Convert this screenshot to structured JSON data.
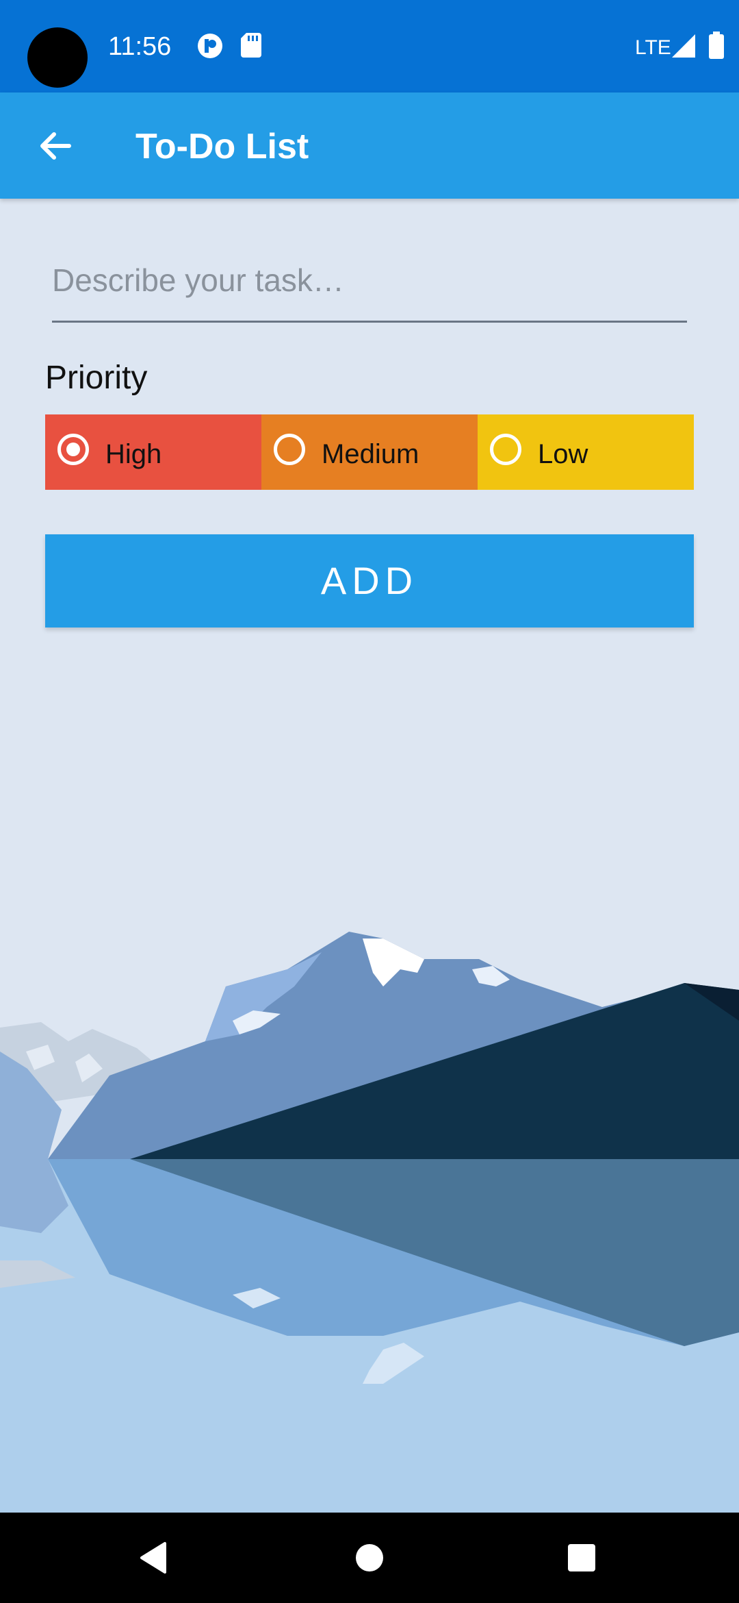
{
  "status_bar": {
    "time": "11:56",
    "network": "LTE",
    "icons": [
      "camera-cutout",
      "notification-icon",
      "sd-card-icon",
      "signal-icon",
      "battery-icon"
    ]
  },
  "app_bar": {
    "title": "To-Do List",
    "back_icon": "arrow-left-icon"
  },
  "form": {
    "task_placeholder": "Describe your task…",
    "task_value": "",
    "priority_label": "Priority",
    "priorities": [
      {
        "label": "High",
        "color": "#e85140",
        "selected": true
      },
      {
        "label": "Medium",
        "color": "#e67f22",
        "selected": false
      },
      {
        "label": "Low",
        "color": "#f1c410",
        "selected": false
      }
    ],
    "add_label": "ADD"
  },
  "colors": {
    "status_bar": "#0672d4",
    "app_bar": "#249de6",
    "background": "#dde6f2",
    "button": "#249de6"
  },
  "nav_bar": {
    "icons": [
      "back-triangle-icon",
      "home-circle-icon",
      "recents-square-icon"
    ]
  }
}
